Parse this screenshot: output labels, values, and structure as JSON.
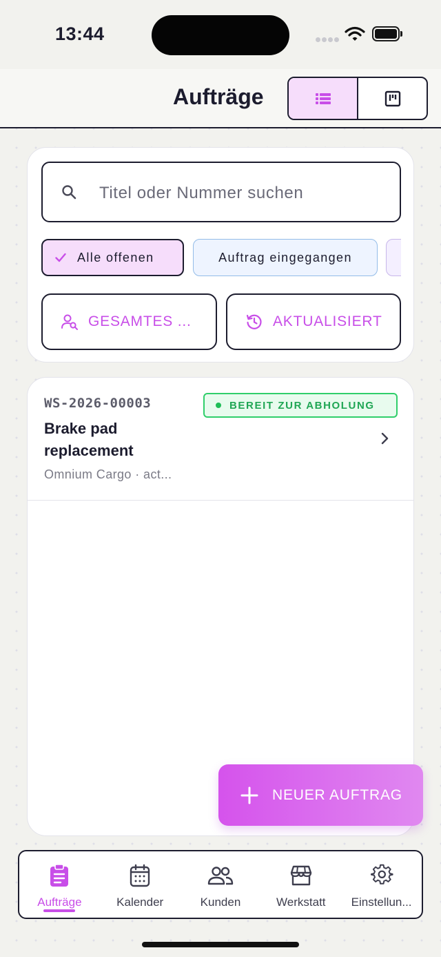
{
  "status_bar": {
    "time": "13:44"
  },
  "header": {
    "title": "Aufträge"
  },
  "search": {
    "placeholder": "Titel oder Nummer suchen"
  },
  "filters": {
    "chips": [
      "Alle offenen",
      "Auftrag eingegangen"
    ],
    "scope_button": "GESAMTES ...",
    "sort_button": "AKTUALISIERT"
  },
  "orders": [
    {
      "number": "WS-2026-00003",
      "status": "BEREIT ZUR ABHOLUNG",
      "title": "Brake pad replacement",
      "subtitle": "Omnium Cargo · act..."
    }
  ],
  "fab": {
    "label": "NEUER AUFTRAG"
  },
  "tabs": [
    {
      "label": "Aufträge",
      "icon": "clipboard-icon",
      "active": true
    },
    {
      "label": "Kalender",
      "icon": "calendar-icon"
    },
    {
      "label": "Kunden",
      "icon": "users-icon"
    },
    {
      "label": "Werkstatt",
      "icon": "store-icon"
    },
    {
      "label": "Einstellun...",
      "icon": "gear-icon"
    }
  ],
  "colors": {
    "accent": "#c84ee8",
    "accent_light": "#f6ddfb",
    "status_green": "#1fa654",
    "border": "#1c1c2e"
  }
}
